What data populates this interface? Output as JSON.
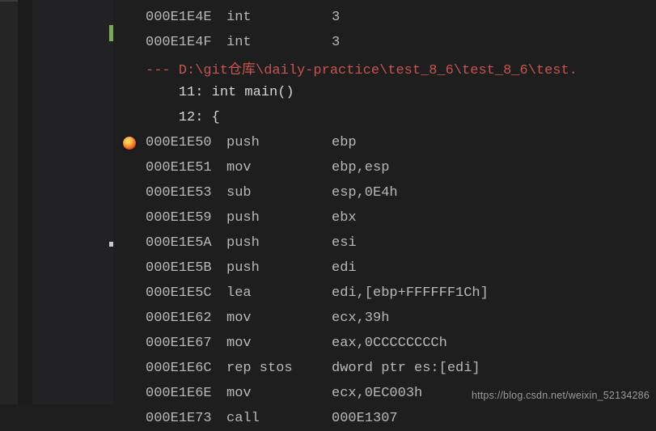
{
  "source_path_line": "--- D:\\git仓库\\daily-practice\\test_8_6\\test_8_6\\test.",
  "source_lines": [
    {
      "num": "11",
      "code": "int main()"
    },
    {
      "num": "12",
      "code": "{"
    }
  ],
  "rows": [
    {
      "addr": "000E1E4E",
      "mn": "int",
      "ops": "3",
      "bp": false
    },
    {
      "addr": "000E1E4F",
      "mn": "int",
      "ops": "3",
      "bp": false
    },
    {
      "type": "srcpath"
    },
    {
      "type": "srcline",
      "idx": 0
    },
    {
      "type": "srcline",
      "idx": 1
    },
    {
      "addr": "000E1E50",
      "mn": "push",
      "ops": "ebp",
      "bp": true
    },
    {
      "addr": "000E1E51",
      "mn": "mov",
      "ops": "ebp,esp",
      "bp": false
    },
    {
      "addr": "000E1E53",
      "mn": "sub",
      "ops": "esp,0E4h",
      "bp": false
    },
    {
      "addr": "000E1E59",
      "mn": "push",
      "ops": "ebx",
      "bp": false
    },
    {
      "addr": "000E1E5A",
      "mn": "push",
      "ops": "esi",
      "bp": false
    },
    {
      "addr": "000E1E5B",
      "mn": "push",
      "ops": "edi",
      "bp": false
    },
    {
      "addr": "000E1E5C",
      "mn": "lea",
      "ops": "edi,[ebp+FFFFFF1Ch]",
      "bp": false
    },
    {
      "addr": "000E1E62",
      "mn": "mov",
      "ops": "ecx,39h",
      "bp": false
    },
    {
      "addr": "000E1E67",
      "mn": "mov",
      "ops": "eax,0CCCCCCCCh",
      "bp": false
    },
    {
      "addr": "000E1E6C",
      "mn": "rep stos",
      "ops": "dword ptr es:[edi]",
      "bp": false
    },
    {
      "addr": "000E1E6E",
      "mn": "mov",
      "ops": "ecx,0EC003h",
      "bp": false
    },
    {
      "addr": "000E1E73",
      "mn": "call",
      "ops": "000E1307",
      "bp": false
    }
  ],
  "watermark": "https://blog.csdn.net/weixin_52134286"
}
